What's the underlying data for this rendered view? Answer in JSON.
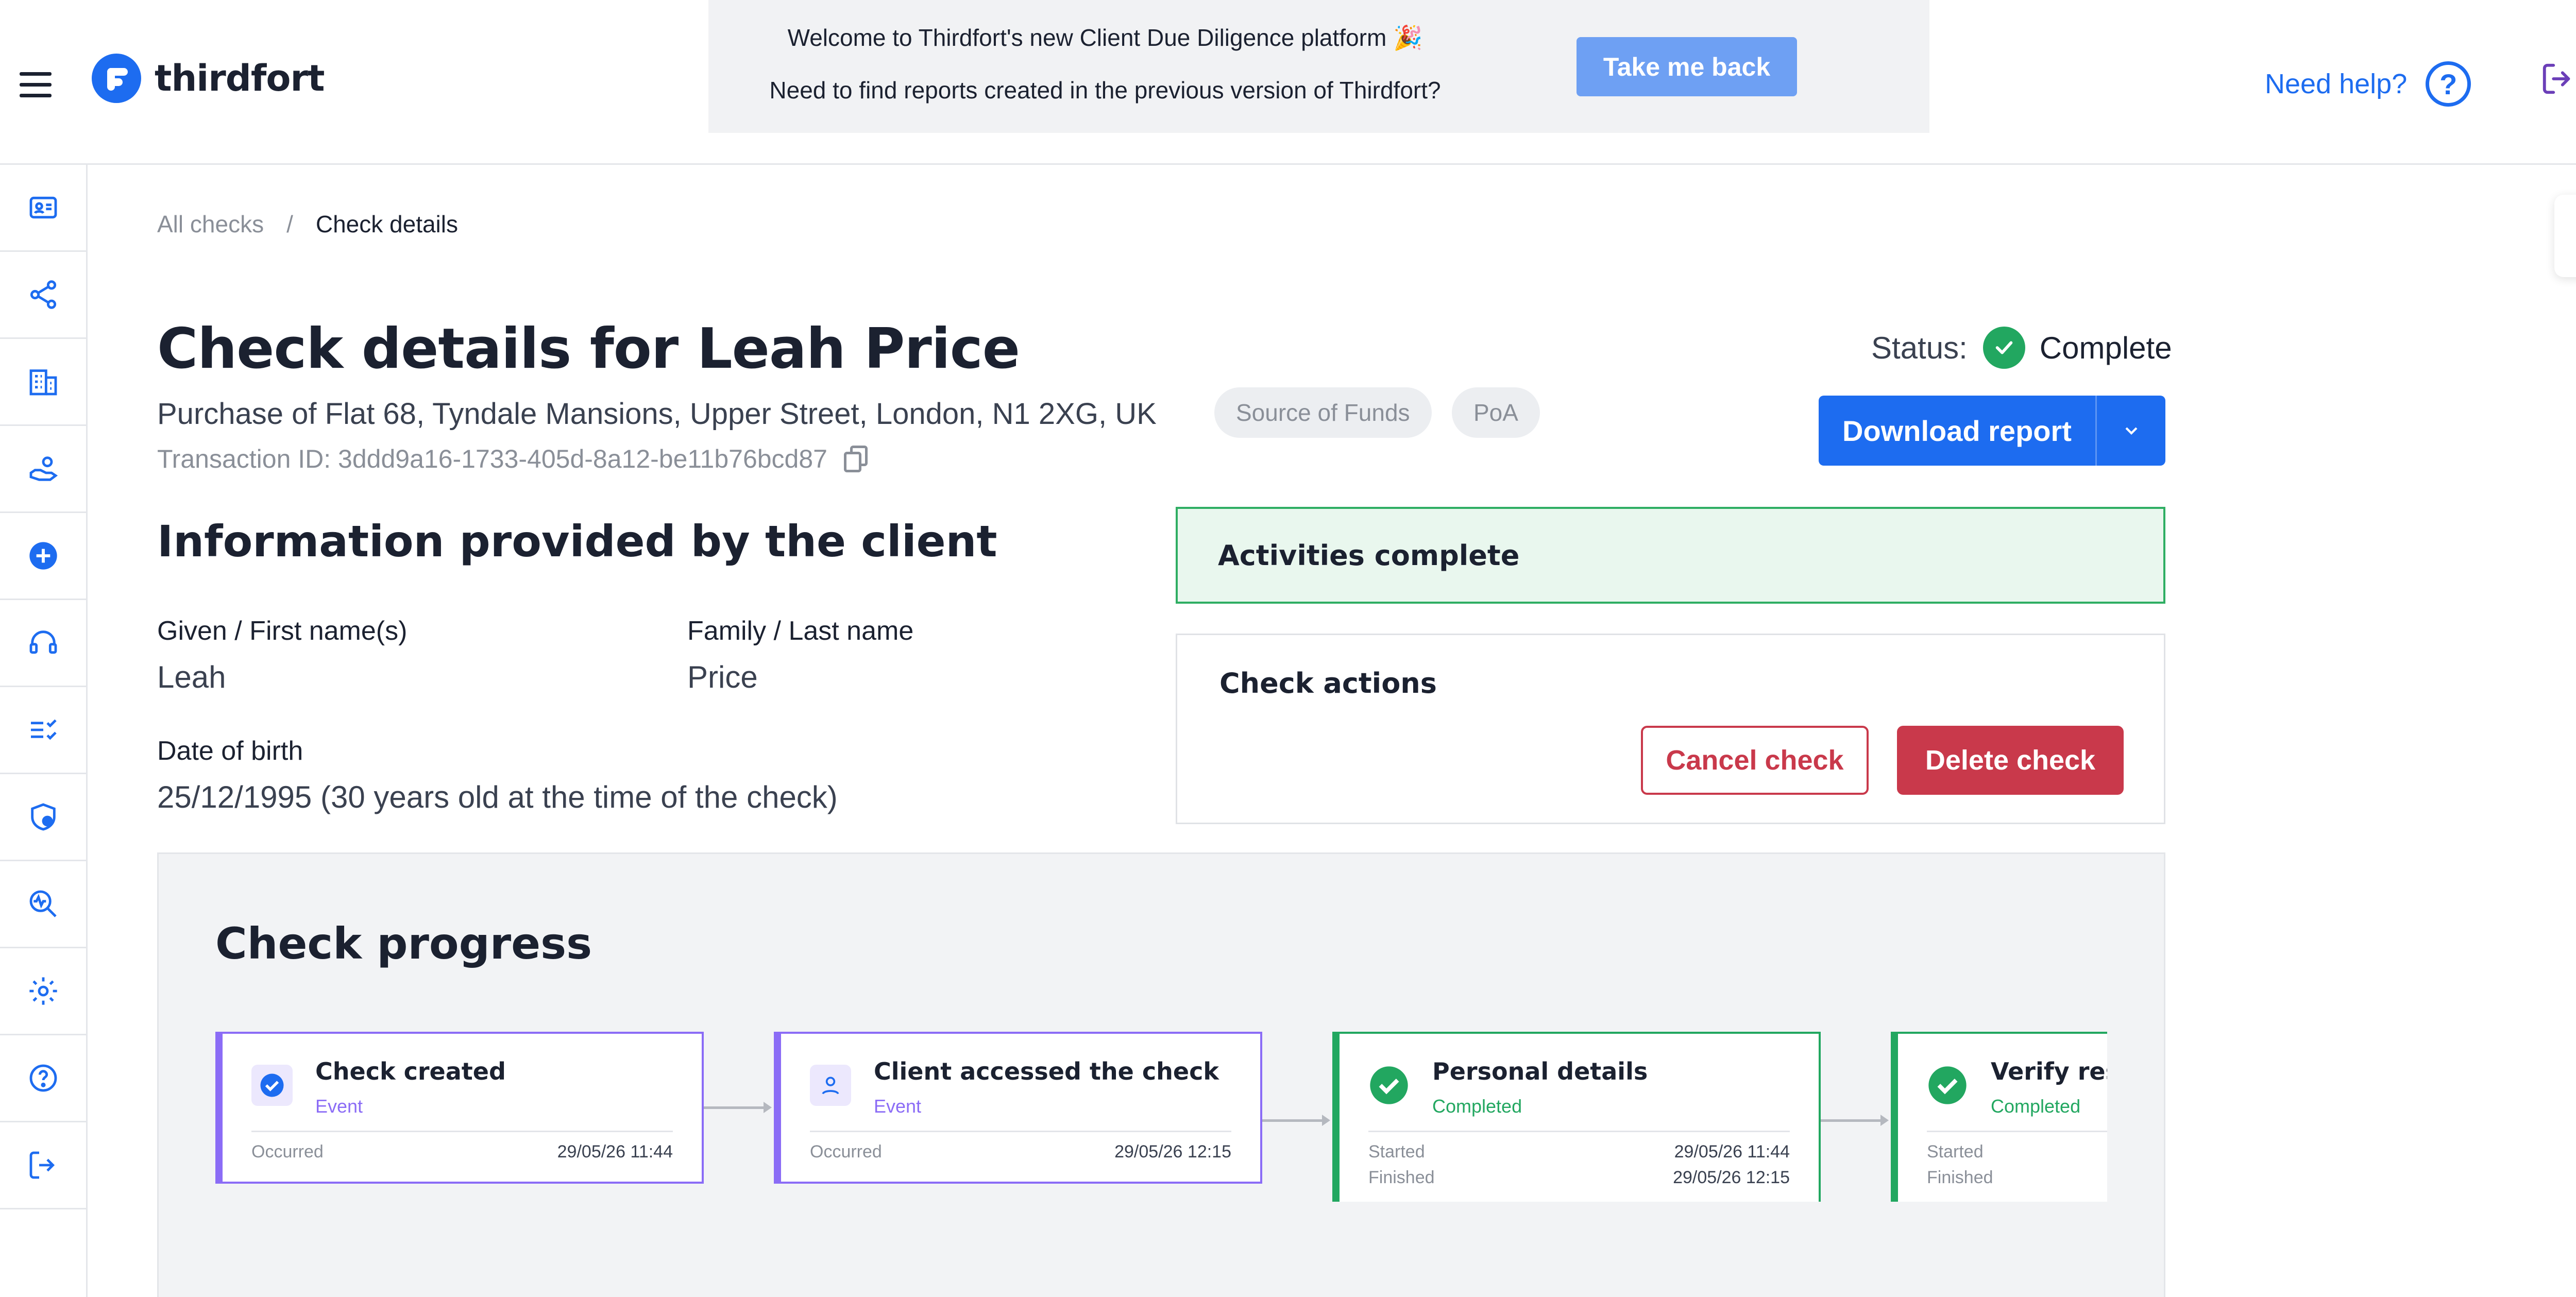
{
  "header": {
    "logo_text": "thirdfort",
    "banner": {
      "line1": "Welcome to Thirdfort's new Client Due Diligence platform 🎉",
      "line2": "Need to find reports created in the previous version of Thirdfort?",
      "button": "Take me back"
    },
    "help_label": "Need help?",
    "help_icon": "?"
  },
  "sidebar": {
    "items": [
      {
        "icon": "id-card-icon"
      },
      {
        "icon": "share-icon"
      },
      {
        "icon": "building-icon"
      },
      {
        "icon": "hand-coins-icon"
      },
      {
        "icon": "add-circle-icon"
      },
      {
        "icon": "headset-icon"
      },
      {
        "icon": "checklist-icon"
      },
      {
        "icon": "shield-user-icon"
      },
      {
        "icon": "search-chart-icon"
      },
      {
        "icon": "gear-icon"
      },
      {
        "icon": "help-circle-icon"
      },
      {
        "icon": "logout-icon"
      }
    ]
  },
  "collapse_tab": "‹",
  "breadcrumb": {
    "link": "All checks",
    "separator": "/",
    "current": "Check details"
  },
  "check": {
    "title": "Check details for Leah Price",
    "address": "Purchase of Flat 68, Tyndale Mansions, Upper Street, London, N1 2XG, UK",
    "tags": [
      "Source of Funds",
      "PoA"
    ],
    "transaction_id": "Transaction ID: 3ddd9a16-1733-405d-8a12-be11b76bcd87",
    "status_label": "Status:",
    "status_value": "Complete",
    "download_label": "Download report"
  },
  "client_info": {
    "title": "Information provided by the client",
    "given_name_label": "Given / First name(s)",
    "given_name": "Leah",
    "family_name_label": "Family / Last name",
    "family_name": "Price",
    "dob_label": "Date of birth",
    "dob": "25/12/1995 (30 years old at the time of the check)"
  },
  "activities_banner": "Activities complete",
  "actions": {
    "title": "Check actions",
    "cancel": "Cancel check",
    "delete": "Delete check"
  },
  "progress": {
    "title": "Check progress",
    "steps": [
      {
        "title": "Check created",
        "sub": "Event",
        "rows": [
          {
            "k": "Occurred",
            "v": "29/05/26 11:44"
          }
        ]
      },
      {
        "title": "Client accessed the check",
        "sub": "Event",
        "rows": [
          {
            "k": "Occurred",
            "v": "29/05/26 12:15"
          }
        ]
      },
      {
        "title": "Personal details",
        "sub": "Completed",
        "rows": [
          {
            "k": "Started",
            "v": "29/05/26 11:44"
          },
          {
            "k": "Finished",
            "v": "29/05/26 12:15"
          }
        ]
      },
      {
        "title": "Verify residence",
        "sub": "Completed",
        "rows": [
          {
            "k": "Started",
            "v": ""
          },
          {
            "k": "Finished",
            "v": ""
          }
        ]
      }
    ]
  },
  "colors": {
    "brand_blue": "#1d6cf0",
    "event_purple": "#8b6cf6",
    "complete_green": "#22a760",
    "danger_red": "#c9394b"
  }
}
